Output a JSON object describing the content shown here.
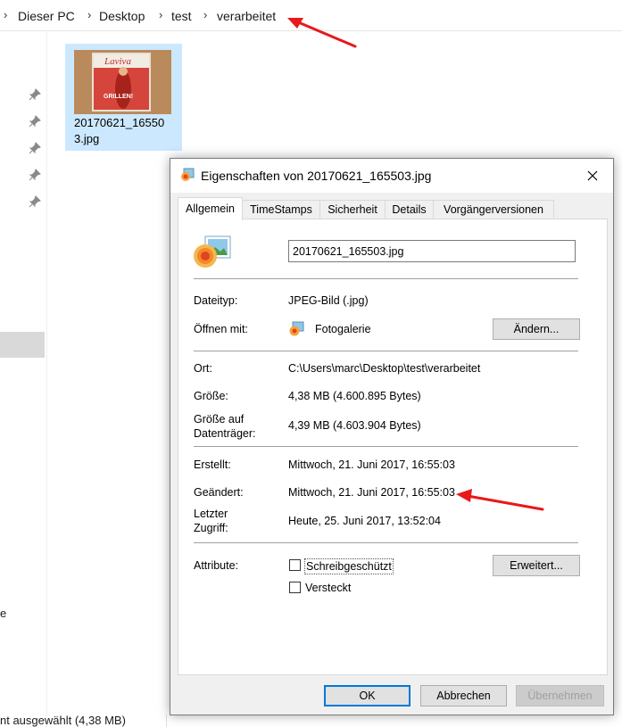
{
  "explorer": {
    "breadcrumb": [
      "Dieser PC",
      "Desktop",
      "test",
      "verarbeitet"
    ],
    "file_name": "20170621_165503.jpg",
    "file_name_line1": "20170621_16550",
    "file_name_line2": "3.jpg",
    "thumb_title": "Laviva",
    "thumb_text": "GRILLEN!",
    "nav_partial": "e",
    "status": "nt ausgewählt (4,38 MB)"
  },
  "dialog": {
    "title": "Eigenschaften von 20170621_165503.jpg",
    "tabs": [
      {
        "label": "Allgemein",
        "active": true
      },
      {
        "label": "TimeStamps",
        "active": false
      },
      {
        "label": "Sicherheit",
        "active": false
      },
      {
        "label": "Details",
        "active": false
      },
      {
        "label": "Vorgängerversionen",
        "active": false
      }
    ],
    "general": {
      "filename_value": "20170621_165503.jpg",
      "dateityp_label": "Dateityp:",
      "dateityp_value": "JPEG-Bild (.jpg)",
      "oeffnen_label": "Öffnen mit:",
      "oeffnen_value": "Fotogalerie",
      "aendern_button": "Ändern...",
      "ort_label": "Ort:",
      "ort_value": "C:\\Users\\marc\\Desktop\\test\\verarbeitet",
      "groesse_label": "Größe:",
      "groesse_value": "4,38 MB (4.600.895 Bytes)",
      "groesse_dt_label_1": "Größe auf",
      "groesse_dt_label_2": "Datenträger:",
      "groesse_dt_value": "4,39 MB (4.603.904 Bytes)",
      "erstellt_label": "Erstellt:",
      "erstellt_value": "Mittwoch, 21. Juni 2017, 16:55:03",
      "geaendert_label": "Geändert:",
      "geaendert_value": "Mittwoch, 21. Juni 2017, 16:55:03",
      "zugriff_label_1": "Letzter",
      "zugriff_label_2": "Zugriff:",
      "zugriff_value": "Heute, 25. Juni 2017, 13:52:04",
      "attribute_label": "Attribute:",
      "schreibgeschuetzt": "Schreibgeschützt",
      "versteckt": "Versteckt",
      "erweitert_button": "Erweitert..."
    },
    "buttons": {
      "ok": "OK",
      "abbrechen": "Abbrechen",
      "uebernehmen": "Übernehmen"
    }
  },
  "colors": {
    "annotation_arrow": "#e8191a",
    "selection": "#cce8ff",
    "dialog_bg": "#f0f0f0",
    "focus_blue": "#0078d7"
  }
}
